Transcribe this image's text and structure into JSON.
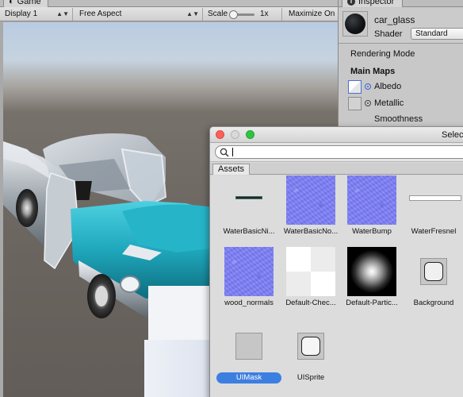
{
  "game": {
    "tab_label": "Game",
    "toolbar": {
      "display": "Display 1",
      "aspect": "Free Aspect",
      "scale_label": "Scale",
      "scale_value": "1x",
      "maximize_label": "Maximize On"
    }
  },
  "inspector": {
    "tab_label": "Inspector",
    "material_name": "car_glass",
    "shader_label": "Shader",
    "shader_value": "Standard",
    "rendering_mode_label": "Rendering Mode",
    "main_maps_label": "Main Maps",
    "albedo_label": "Albedo",
    "metallic_label": "Metallic",
    "smoothness_label": "Smoothness"
  },
  "select_window": {
    "title": "Select Texture",
    "search_value": "",
    "tab_label": "Assets",
    "items": [
      {
        "label": "WaterBasicNi...",
        "kind": "line-dark"
      },
      {
        "label": "WaterBasicNo...",
        "kind": "normal"
      },
      {
        "label": "WaterBump",
        "kind": "normal"
      },
      {
        "label": "WaterFresnel",
        "kind": "line-white"
      },
      {
        "label": "wood_normals",
        "kind": "normal"
      },
      {
        "label": "Default-Chec...",
        "kind": "checker"
      },
      {
        "label": "Default-Partic...",
        "kind": "particle"
      },
      {
        "label": "Background",
        "kind": "rounded-sprite"
      },
      {
        "label": "UIMask",
        "kind": "plain-gray",
        "selected": true
      },
      {
        "label": "UISprite",
        "kind": "rounded-sprite"
      }
    ]
  },
  "colors": {
    "selection_blue": "#3d7fe0",
    "car_teal": "#1fa8bd",
    "normal_map_blue": "#7e80f7"
  }
}
